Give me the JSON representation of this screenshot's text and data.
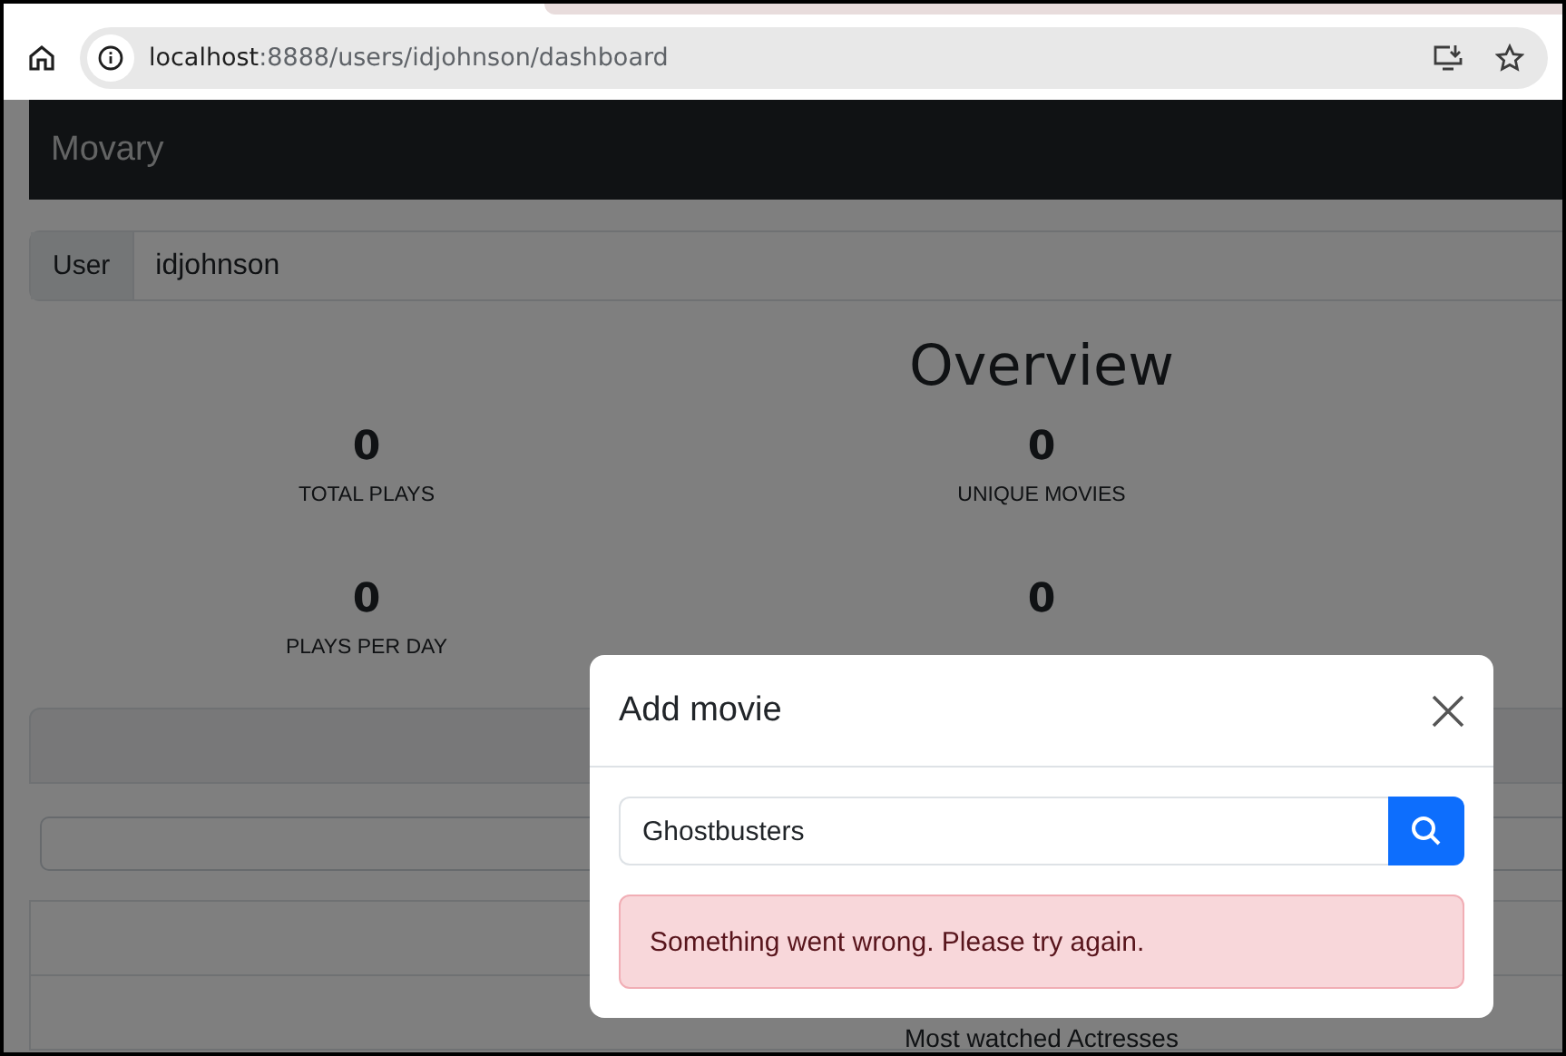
{
  "browser": {
    "url_host": "localhost",
    "url_path": ":8888/users/idjohnson/dashboard"
  },
  "navbar": {
    "brand": "Movary"
  },
  "user_select": {
    "label": "User",
    "value": "idjohnson"
  },
  "overview": {
    "title": "Overview",
    "stat_rows": [
      [
        {
          "value": "0",
          "label": "TOTAL PLAYS"
        },
        {
          "value": "0",
          "label": "UNIQUE MOVIES"
        }
      ],
      [
        {
          "value": "0",
          "label": "PLAYS PER DAY"
        },
        {
          "value": "0"
        }
      ]
    ]
  },
  "section_below": {
    "heading": "Most watched Actresses"
  },
  "modal": {
    "title": "Add movie",
    "search_value": "Ghostbusters",
    "alert": "Something went wrong. Please try again."
  }
}
